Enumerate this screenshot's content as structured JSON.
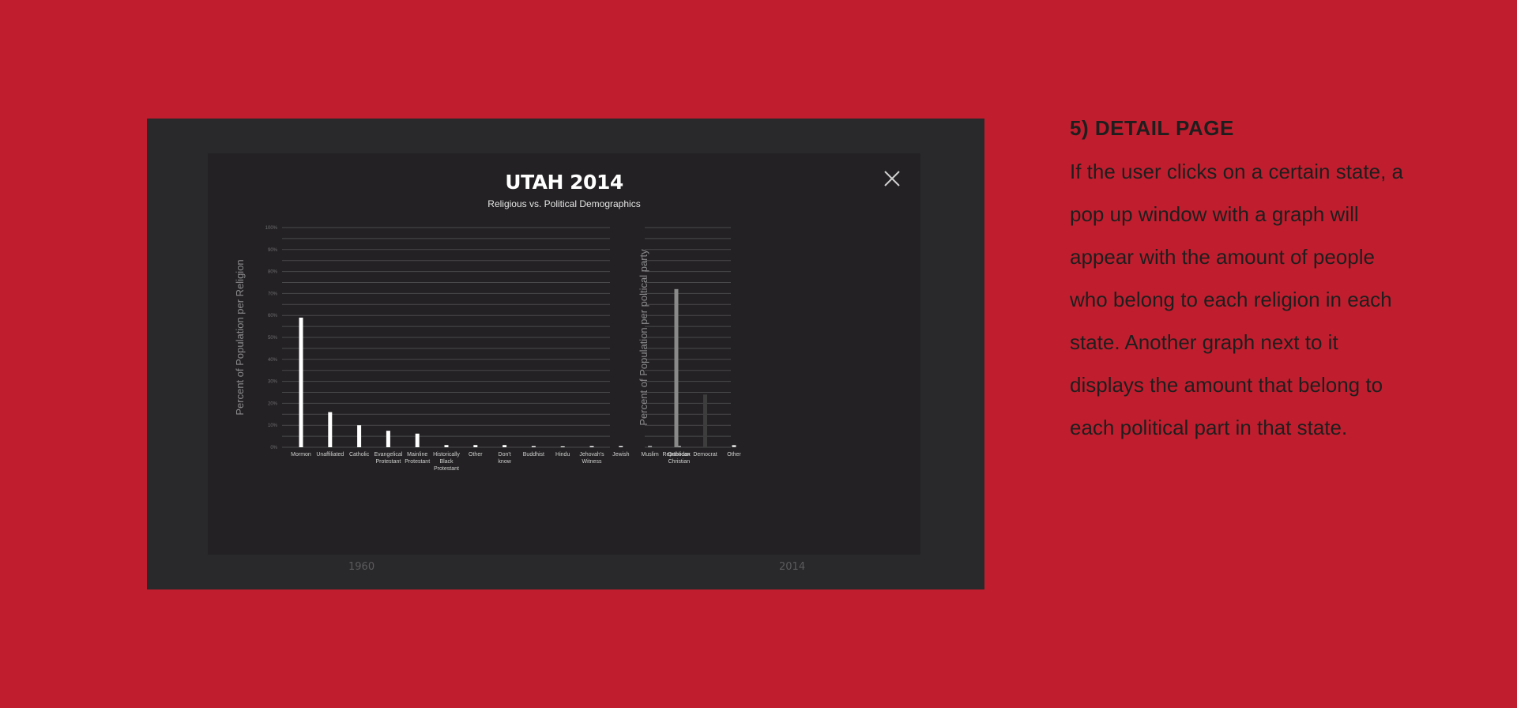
{
  "background_screen": {
    "year_left": "1960",
    "year_right": "2014"
  },
  "modal": {
    "title": "UTAH 2014",
    "subtitle": "Religious vs. Political Demographics",
    "close_icon": "close-icon"
  },
  "chart_data": [
    {
      "type": "bar",
      "ylabel": "Percent of Population per Religion",
      "ylim": [
        0,
        100
      ],
      "yticks": [
        "0%",
        "10%",
        "20%",
        "30%",
        "40%",
        "50%",
        "60%",
        "70%",
        "80%",
        "90%",
        "100%"
      ],
      "grid": true,
      "categories": [
        "Mormon",
        "Unaffiliated",
        "Catholic",
        "Evangelical Protestant",
        "Mainline Protestant",
        "Historically Black Protestant",
        "Other",
        "Don't know",
        "Buddhist",
        "Hindu",
        "Jehovah's Witness",
        "Jewish",
        "Muslim",
        "Orthodox Christian"
      ],
      "values": [
        59,
        16,
        10,
        7.5,
        6.2,
        1,
        1,
        1,
        0.5,
        0.4,
        0.5,
        0.5,
        0.5,
        0.5
      ],
      "bar_color": "#ffffff"
    },
    {
      "type": "bar",
      "ylabel": "Percent of Population per poltical party",
      "ylim": [
        0,
        100
      ],
      "grid": true,
      "categories": [
        "Republican",
        "Democrat",
        "Other"
      ],
      "values": [
        72,
        24,
        1
      ],
      "bar_colors": [
        "#8a8a8a",
        "#3d3d3d",
        "#d9d9d9"
      ]
    }
  ],
  "caption": {
    "title": "5) DETAIL PAGE",
    "text": "If the user clicks on a certain state, a pop up window with a graph will appear with the amount of people who belong to each religion in each state. Another graph next to it displays the amount that belong to each political part in that state."
  }
}
